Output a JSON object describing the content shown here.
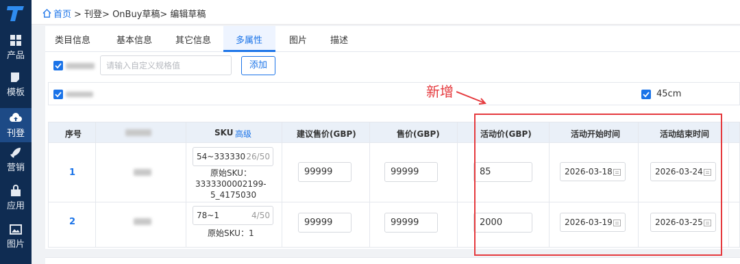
{
  "sidebar": {
    "items": [
      {
        "label": "产品",
        "icon": "grid-icon"
      },
      {
        "label": "模板",
        "icon": "template-icon"
      },
      {
        "label": "刊登",
        "icon": "upload-cloud-icon"
      },
      {
        "label": "营销",
        "icon": "rocket-icon"
      },
      {
        "label": "应用",
        "icon": "bag-icon"
      },
      {
        "label": "图片",
        "icon": "image-icon"
      }
    ],
    "active_index": 2
  },
  "breadcrumb": {
    "home": "首页",
    "path": "> 刊登> OnBuy草稿> 编辑草稿"
  },
  "tabs": [
    "类目信息",
    "基本信息",
    "其它信息",
    "多属性",
    "图片",
    "描述"
  ],
  "active_tab": "多属性",
  "custom_spec": {
    "placeholder": "请输入自定义规格值",
    "add_label": "添加"
  },
  "size_option": "45cm",
  "annotation": "新增",
  "table": {
    "headers": {
      "index": "序号",
      "sku": "SKU",
      "advanced": "高级",
      "suggested_price": "建议售价(GBP)",
      "price": "售价(GBP)",
      "promo_price": "活动价(GBP)",
      "start_time": "活动开始时间",
      "end_time": "活动结束时间"
    },
    "rows": [
      {
        "index": "1",
        "sku": "54~3333300(",
        "sku_count": "26/50",
        "orig_label": "原始SKU：",
        "orig_sku_line1": "3333300002199-",
        "orig_sku_line2": "5_4175030",
        "suggested_price": "99999",
        "price": "99999",
        "promo_price": "85",
        "start": "2026-03-18",
        "end": "2026-03-24"
      },
      {
        "index": "2",
        "sku": "78~1",
        "sku_count": "4/50",
        "orig_text": "原始SKU：1",
        "suggested_price": "99999",
        "price": "99999",
        "promo_price": "2000",
        "start": "2026-03-19",
        "end": "2026-03-25"
      }
    ]
  },
  "colors": {
    "accent": "#1a73e8",
    "sidebar": "#0f2c52",
    "annotation": "#e5393d"
  }
}
